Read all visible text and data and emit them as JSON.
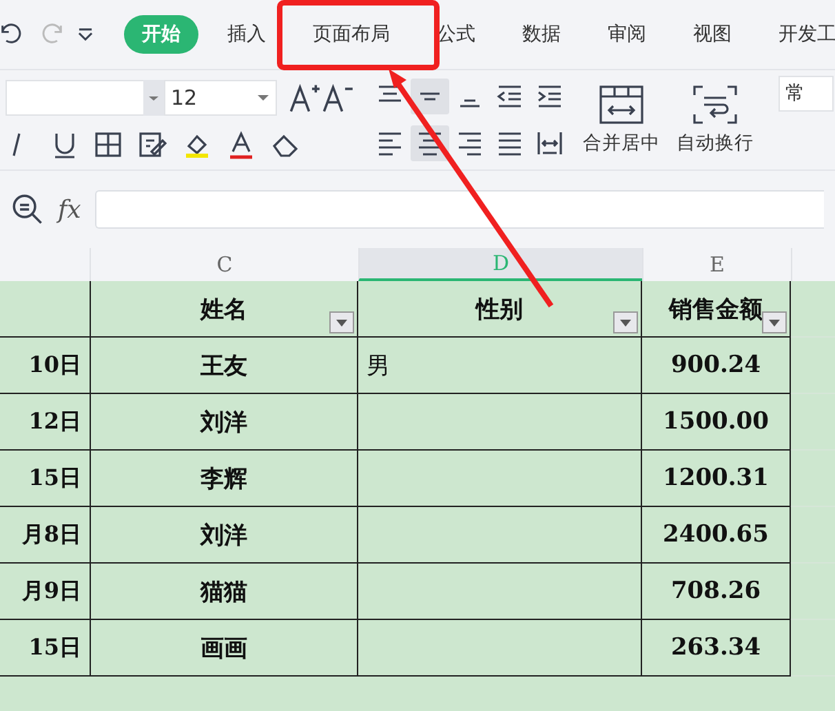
{
  "ribbon_tabs": [
    {
      "label": "开始",
      "selected": true
    },
    {
      "label": "插入",
      "selected": false
    },
    {
      "label": "页面布局",
      "selected": false
    },
    {
      "label": "公式",
      "selected": false
    },
    {
      "label": "数据",
      "selected": false
    },
    {
      "label": "审阅",
      "selected": false
    },
    {
      "label": "视图",
      "selected": false
    },
    {
      "label": "开发工",
      "selected": false
    }
  ],
  "toolbar": {
    "font_size": "12",
    "align_buttons": [
      {
        "kind": "top",
        "selected": false
      },
      {
        "kind": "middle",
        "selected": true
      },
      {
        "kind": "bottom",
        "selected": false
      },
      {
        "kind": "outdent",
        "selected": false
      },
      {
        "kind": "indent",
        "selected": false
      },
      {
        "kind": "left",
        "selected": false
      },
      {
        "kind": "center",
        "selected": true
      },
      {
        "kind": "right",
        "selected": false
      },
      {
        "kind": "justify",
        "selected": false
      },
      {
        "kind": "distributed",
        "selected": false
      }
    ],
    "merge_label": "合并居中",
    "wrap_label": "自动换行",
    "number_format": "常"
  },
  "formula_bar": {
    "label": "fx"
  },
  "column_headers": [
    {
      "label": "C",
      "selected": false
    },
    {
      "label": "D",
      "selected": true
    },
    {
      "label": "E",
      "selected": false
    }
  ],
  "table": {
    "headers": [
      "姓名",
      "性别",
      "销售金额"
    ],
    "rows": [
      {
        "column_1": "10日",
        "name": "王友",
        "gender": "男",
        "amount": "900.24"
      },
      {
        "column_1": "12日",
        "name": "刘洋",
        "amount": "1500.00"
      },
      {
        "column_1": "15日",
        "name": "李辉",
        "amount": "1200.31"
      },
      {
        "column_1": "月8日",
        "name": "刘洋",
        "amount": "2400.65"
      },
      {
        "column_1": "月9日",
        "name": "猫猫",
        "amount": "708.26"
      },
      {
        "column_1": "15日",
        "name": "画画",
        "amount": "263.34"
      }
    ]
  }
}
